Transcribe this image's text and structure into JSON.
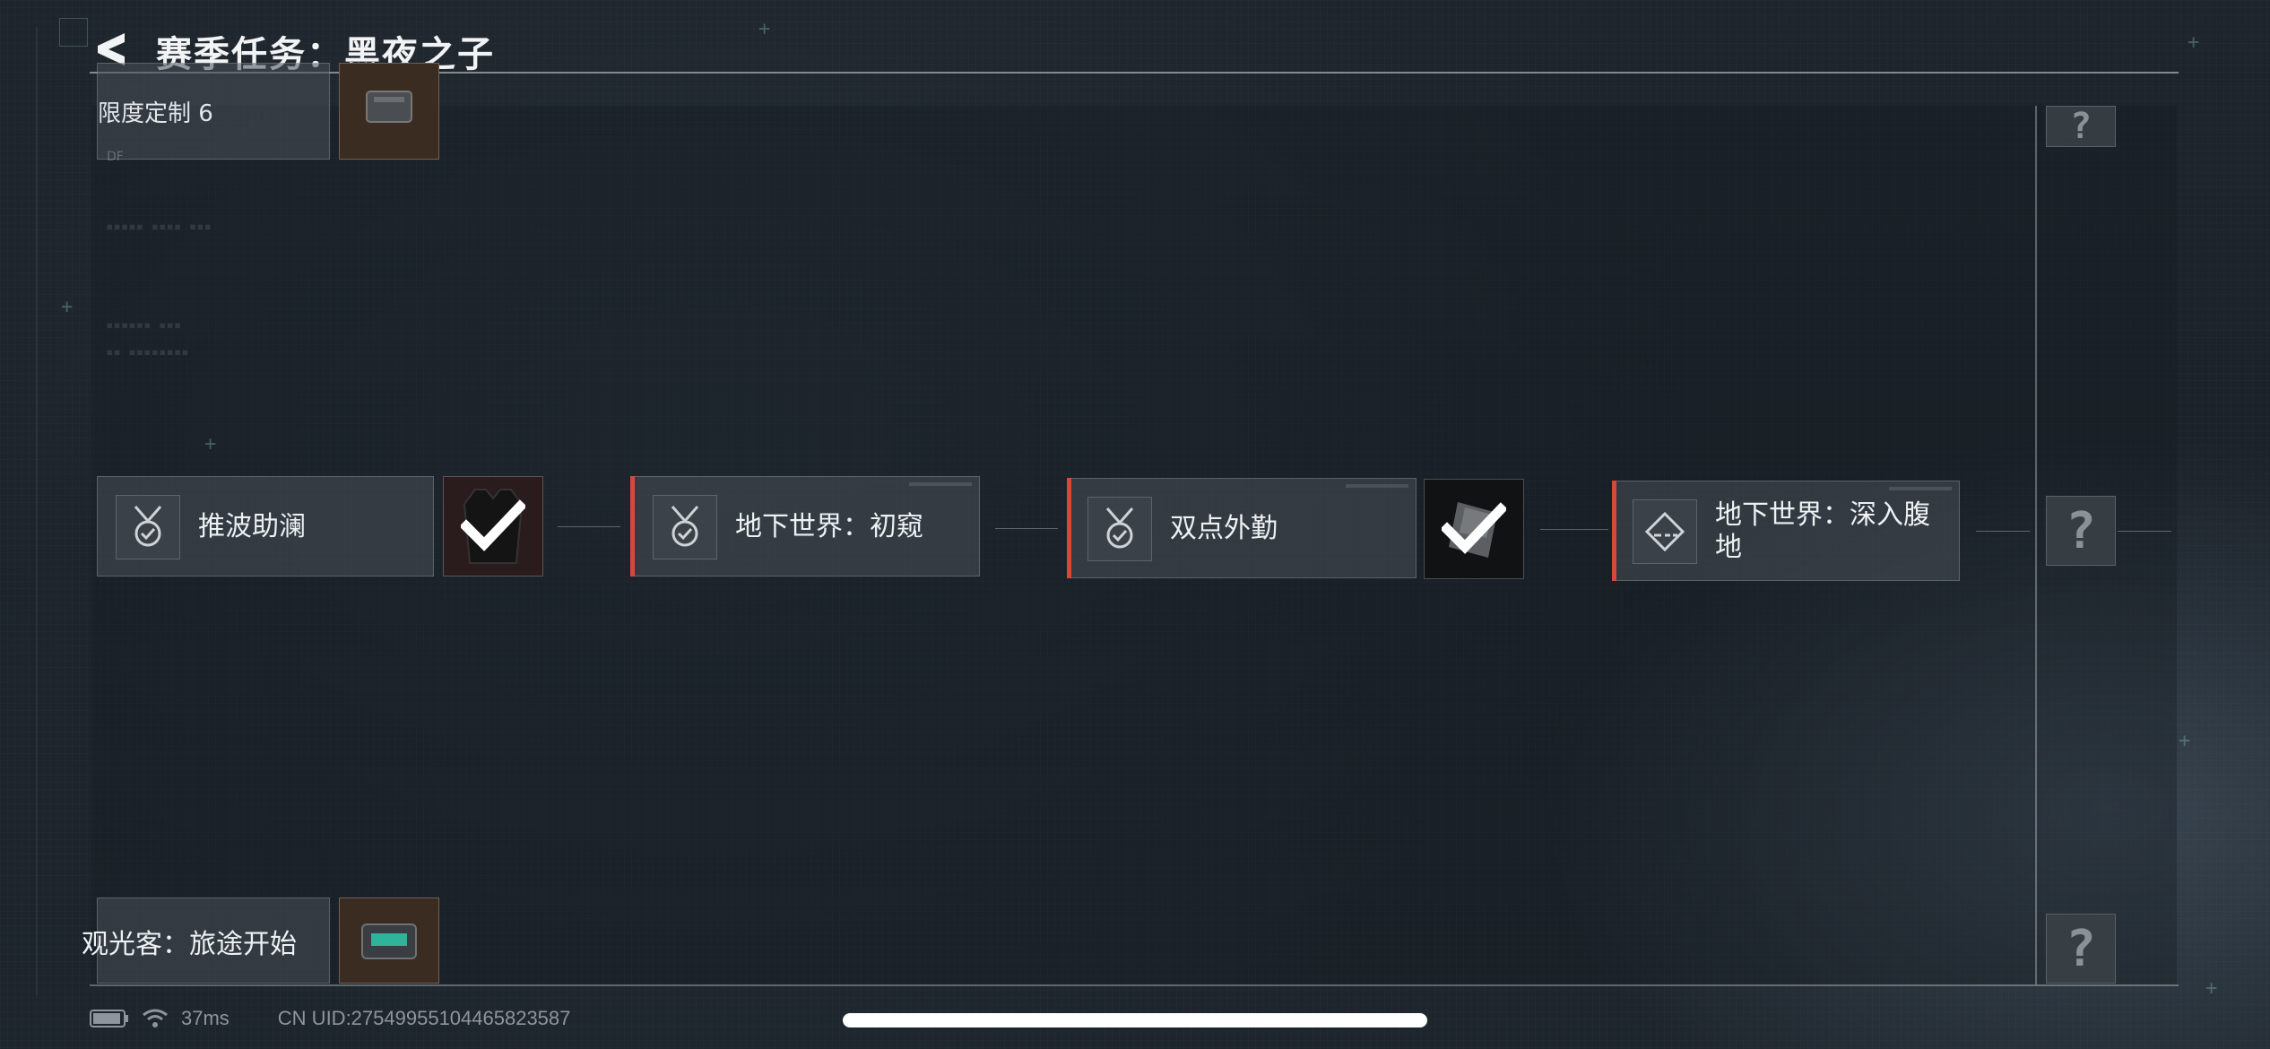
{
  "header": {
    "title": "赛季任务：黑夜之子"
  },
  "tasks": [
    {
      "label": "推波助澜"
    },
    {
      "label": "地下世界：初窥"
    },
    {
      "label": "双点外勤"
    },
    {
      "label": "地下世界：深入腹地"
    }
  ],
  "top_partial_task": {
    "label": "限度定制 6",
    "sub": "DF"
  },
  "bottom_partial_task": {
    "label": "观光客：旅途开始"
  },
  "locked_label": "?",
  "status": {
    "ping": "37ms",
    "uid": "CN UID:27549955104465823587"
  },
  "colors": {
    "accent": "#d6493a",
    "background": "#1b2229"
  }
}
